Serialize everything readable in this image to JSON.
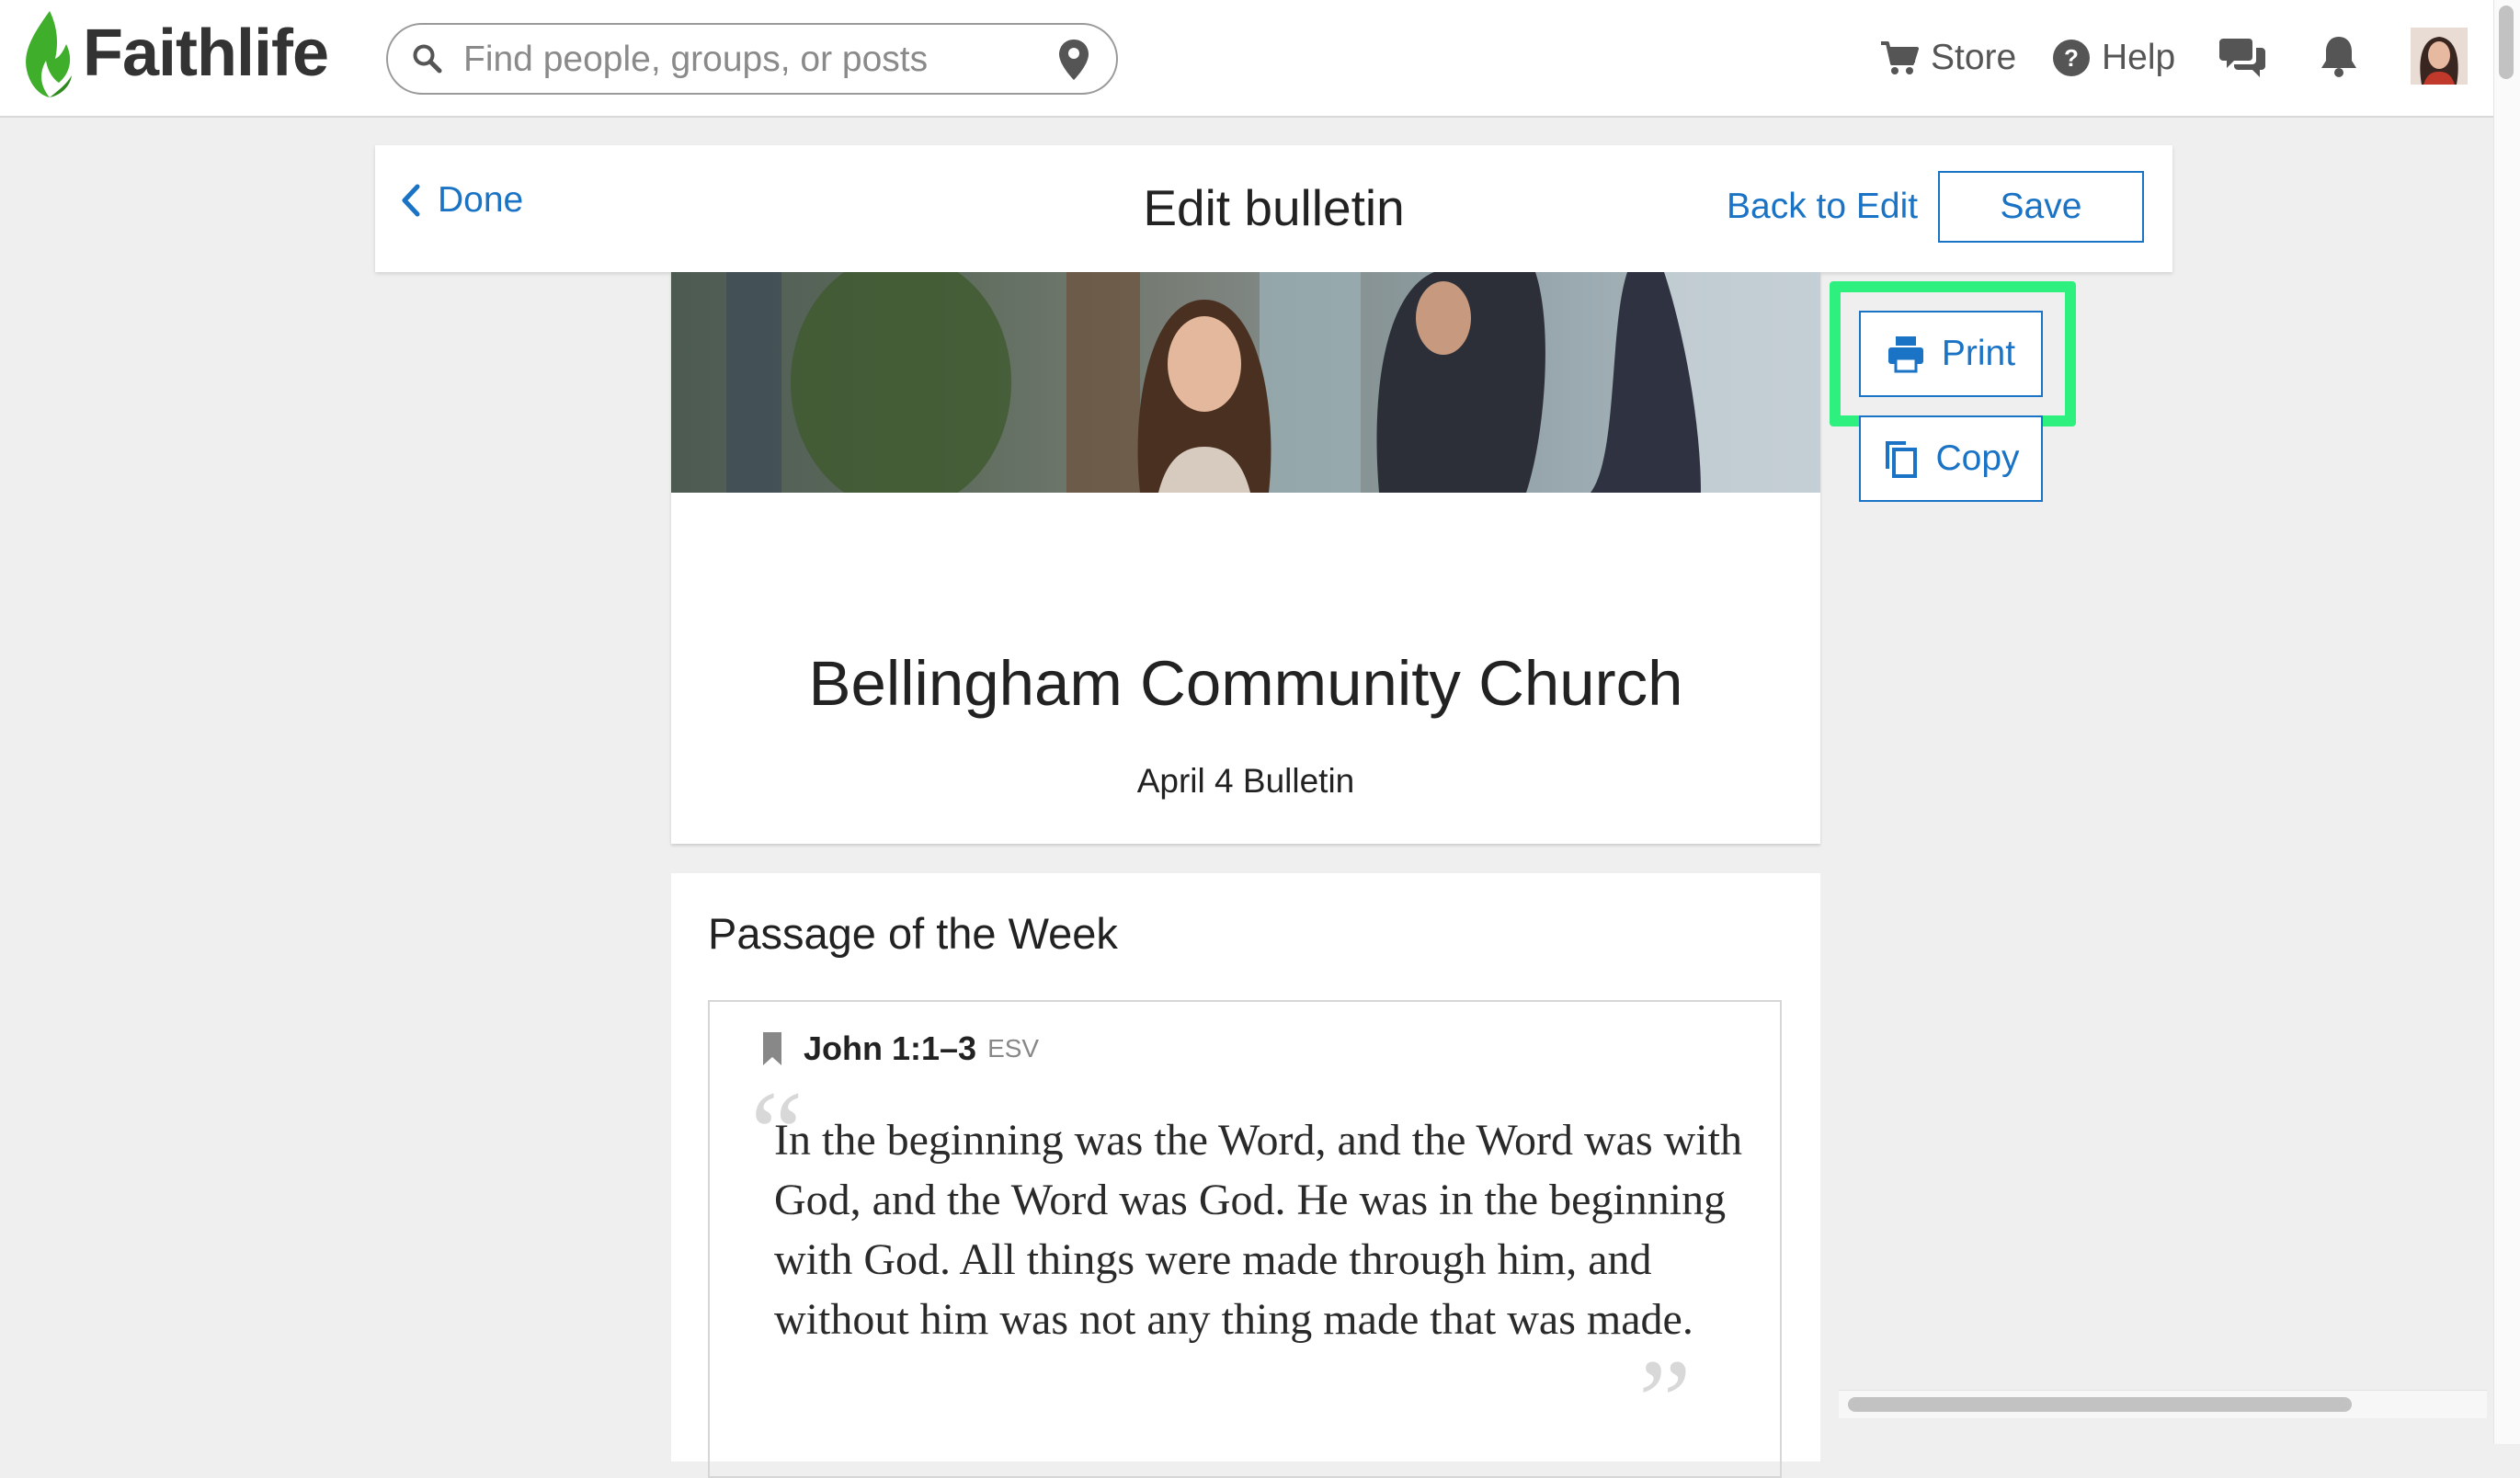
{
  "app": {
    "logo_text": "Faithlife"
  },
  "search": {
    "placeholder": "Find people, groups, or posts",
    "value": ""
  },
  "nav": {
    "store_label": "Store",
    "help_label": "Help"
  },
  "toolbar": {
    "done_label": "Done",
    "title": "Edit bulletin",
    "back_to_edit_label": "Back to Edit",
    "save_label": "Save"
  },
  "bulletin": {
    "church_name": "Bellingham Community Church",
    "subtitle": "April 4 Bulletin"
  },
  "passage": {
    "section_title": "Passage of the Week",
    "reference": "John 1:1–3",
    "version": "ESV",
    "text": "In the beginning was the Word, and the Word was with God, and the Word was God. He was in the beginning with God. All things were made through him, and without him was not any thing made that was made."
  },
  "side_actions": {
    "print_label": "Print",
    "copy_label": "Copy"
  },
  "colors": {
    "accent": "#1a73c4",
    "highlight": "#2ef07e",
    "logo_green": "#3fae2a"
  },
  "icons": [
    "faithlife-flame-icon",
    "search-icon",
    "location-pin-icon",
    "cart-icon",
    "help-icon",
    "chat-icon",
    "bell-icon",
    "avatar",
    "chevron-left-icon",
    "print-icon",
    "copy-icon",
    "bookmark-icon"
  ]
}
